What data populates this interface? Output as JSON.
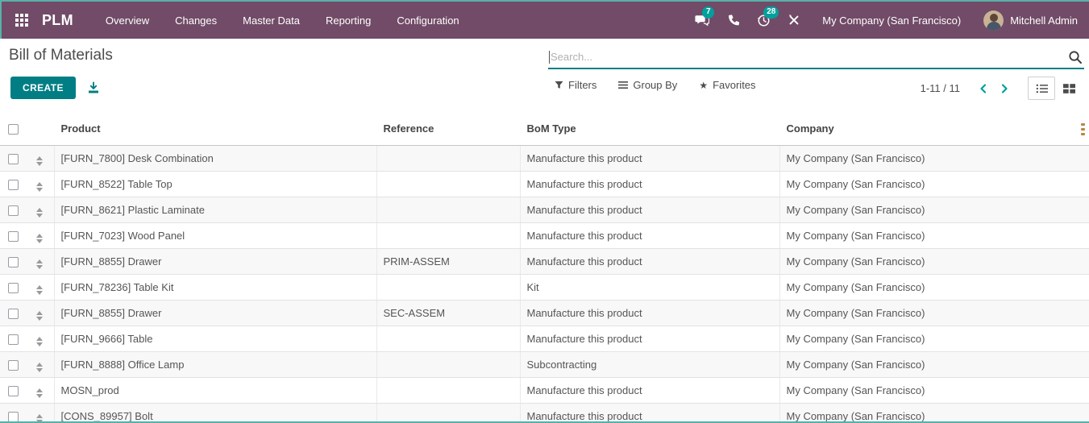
{
  "topbar": {
    "app_name": "PLM",
    "menu": [
      "Overview",
      "Changes",
      "Master Data",
      "Reporting",
      "Configuration"
    ],
    "messages_badge": "7",
    "activities_badge": "28",
    "company": "My Company (San Francisco)",
    "user": "Mitchell Admin"
  },
  "control_panel": {
    "title": "Bill of Materials",
    "create_label": "CREATE",
    "search_placeholder": "Search...",
    "filters_label": "Filters",
    "group_by_label": "Group By",
    "favorites_label": "Favorites",
    "pager": "1-11 / 11"
  },
  "table": {
    "columns": [
      "Product",
      "Reference",
      "BoM Type",
      "Company"
    ],
    "rows": [
      {
        "product": "[FURN_7800] Desk Combination",
        "reference": "",
        "bom_type": "Manufacture this product",
        "company": "My Company (San Francisco)"
      },
      {
        "product": "[FURN_8522] Table Top",
        "reference": "",
        "bom_type": "Manufacture this product",
        "company": "My Company (San Francisco)"
      },
      {
        "product": "[FURN_8621] Plastic Laminate",
        "reference": "",
        "bom_type": "Manufacture this product",
        "company": "My Company (San Francisco)"
      },
      {
        "product": "[FURN_7023] Wood Panel",
        "reference": "",
        "bom_type": "Manufacture this product",
        "company": "My Company (San Francisco)"
      },
      {
        "product": "[FURN_8855] Drawer",
        "reference": "PRIM-ASSEM",
        "bom_type": "Manufacture this product",
        "company": "My Company (San Francisco)"
      },
      {
        "product": "[FURN_78236] Table Kit",
        "reference": "",
        "bom_type": "Kit",
        "company": "My Company (San Francisco)"
      },
      {
        "product": "[FURN_8855] Drawer",
        "reference": "SEC-ASSEM",
        "bom_type": "Manufacture this product",
        "company": "My Company (San Francisco)"
      },
      {
        "product": "[FURN_9666] Table",
        "reference": "",
        "bom_type": "Manufacture this product",
        "company": "My Company (San Francisco)"
      },
      {
        "product": "[FURN_8888] Office Lamp",
        "reference": "",
        "bom_type": "Subcontracting",
        "company": "My Company (San Francisco)"
      },
      {
        "product": "MOSN_prod",
        "reference": "",
        "bom_type": "Manufacture this product",
        "company": "My Company (San Francisco)"
      },
      {
        "product": "[CONS_89957] Bolt",
        "reference": "",
        "bom_type": "Manufacture this product",
        "company": "My Company (San Francisco)"
      }
    ]
  },
  "icons": {
    "apps": "grid-3x3",
    "messages": "chat-bubbles",
    "voip": "phone",
    "activities": "clock",
    "tools": "crossed-tools",
    "search": "magnifier",
    "filters": "funnel",
    "group_by": "bars",
    "favorites": "star",
    "export": "download-tray",
    "pager_prev": "chevron-left",
    "pager_next": "chevron-right",
    "list_view": "list",
    "kanban_view": "grid-2x2",
    "drag": "up-down-triangles",
    "optional_columns": "sliders"
  },
  "colors": {
    "navbar": "#714b67",
    "accent_teal": "#00a09d",
    "button_teal": "#017e84",
    "top_border": "#57b1a9"
  }
}
